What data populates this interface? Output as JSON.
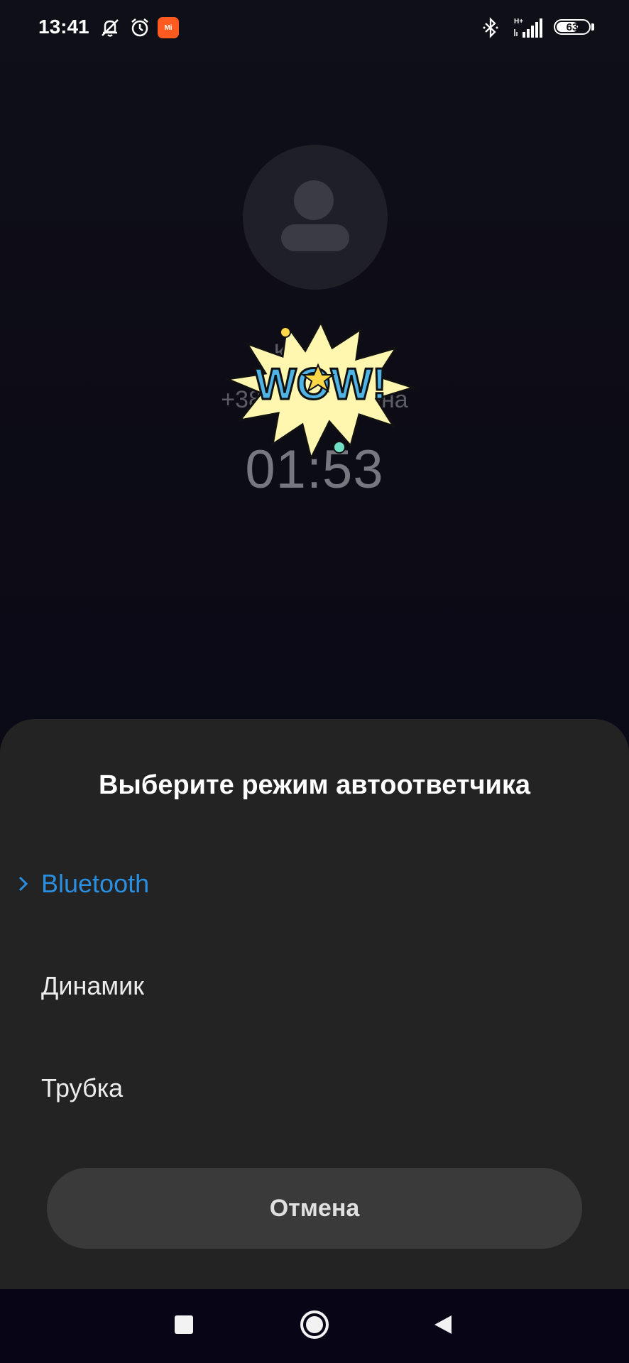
{
  "status_bar": {
    "time": "13:41",
    "battery": "63",
    "battery_percent": 63,
    "network": "H+",
    "icons": [
      "mute-icon",
      "alarm-icon",
      "app-notification-icon",
      "bluetooth-icon",
      "signal-icon",
      "battery-icon"
    ],
    "app_badge_label": "Mi"
  },
  "call": {
    "name": "Кате         ус",
    "number": "+380 93 (        краина",
    "timer": "01:53"
  },
  "sticker": {
    "text": "WOW!"
  },
  "sheet": {
    "title": "Выберите режим автоответчика",
    "options": [
      {
        "label": "Bluetooth",
        "selected": true
      },
      {
        "label": "Динамик",
        "selected": false
      },
      {
        "label": "Трубка",
        "selected": false
      }
    ],
    "cancel": "Отмена"
  },
  "colors": {
    "accent": "#2a8fe0",
    "sheet_bg": "#232323",
    "button_bg": "#3a3a3a",
    "badge": "#ff5a1f"
  }
}
